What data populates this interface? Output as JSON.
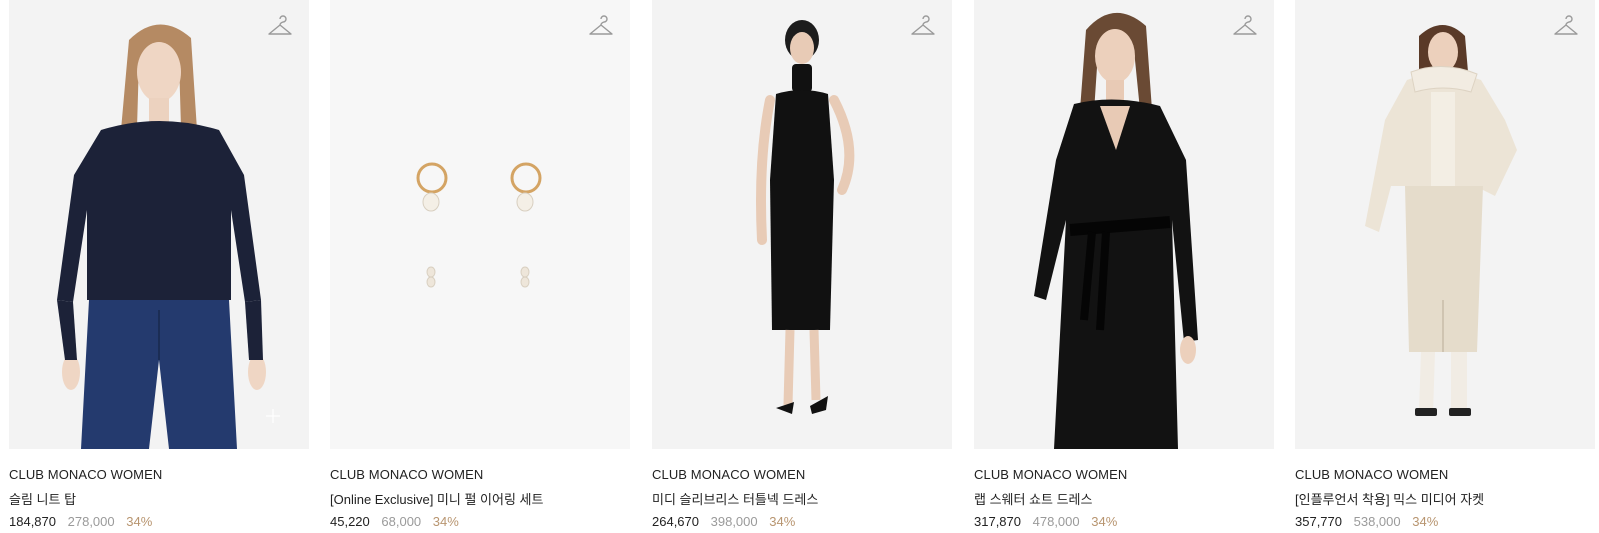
{
  "products": [
    {
      "brand": "CLUB MONACO WOMEN",
      "name": "슬림 니트 탑",
      "sale_price": "184,870",
      "original_price": "278,000",
      "discount": "34%",
      "image": "navy-knit-top-photo"
    },
    {
      "brand": "CLUB MONACO WOMEN",
      "name": "[Online Exclusive] 미니 펄 이어링 세트",
      "sale_price": "45,220",
      "original_price": "68,000",
      "discount": "34%",
      "image": "pearl-earring-set-photo"
    },
    {
      "brand": "CLUB MONACO WOMEN",
      "name": "미디 슬리브리스 터틀넥 드레스",
      "sale_price": "264,670",
      "original_price": "398,000",
      "discount": "34%",
      "image": "black-turtleneck-dress-photo"
    },
    {
      "brand": "CLUB MONACO WOMEN",
      "name": "랩 스웨터 쇼트 드레스",
      "sale_price": "317,870",
      "original_price": "478,000",
      "discount": "34%",
      "image": "black-wrap-sweater-dress-photo"
    },
    {
      "brand": "CLUB MONACO WOMEN",
      "name": "[인플루언서 착용] 믹스 미디어 자켓",
      "sale_price": "357,770",
      "original_price": "538,000",
      "discount": "34%",
      "image": "ivory-mixed-media-jacket-photo"
    }
  ],
  "icons": {
    "wishlist": "hanger-icon",
    "quick_add": "plus-icon"
  },
  "colors": {
    "discount": "#b89570",
    "original_price": "#9a9a9a",
    "text": "#222222",
    "image_bg": "#f3f3f3"
  }
}
